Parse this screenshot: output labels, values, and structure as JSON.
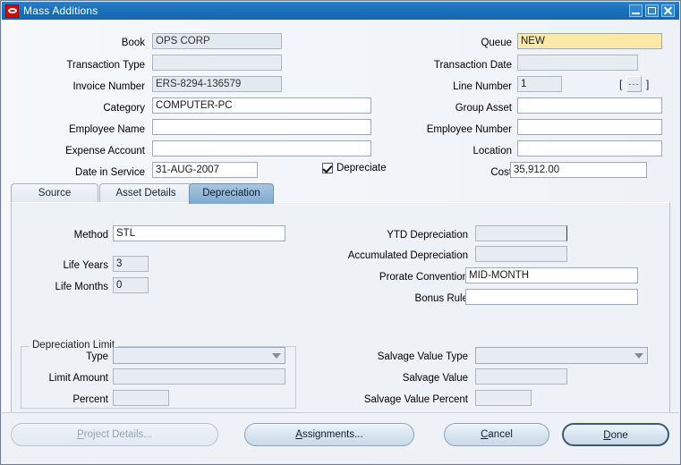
{
  "window": {
    "title": "Mass Additions",
    "logo_icon": "oracle-logo-icon",
    "minimize_label": "Minimize",
    "maximize_label": "Maximize",
    "close_label": "Close"
  },
  "header": {
    "left_fields": [
      {
        "label": "Book",
        "value": "OPS CORP",
        "state": "readonly"
      },
      {
        "label": "Transaction Type",
        "value": "",
        "state": "readonly"
      },
      {
        "label": "Invoice Number",
        "value": "ERS-8294-136579",
        "state": "readonly"
      },
      {
        "label": "Category",
        "value": "COMPUTER-PC",
        "state": "editable"
      },
      {
        "label": "Employee Name",
        "value": "",
        "state": "editable"
      },
      {
        "label": "Expense Account",
        "value": "",
        "state": "editable"
      },
      {
        "label": "Date in Service",
        "value": "31-AUG-2007",
        "state": "editable"
      }
    ],
    "right_fields": [
      {
        "label": "Queue",
        "value": "NEW",
        "state": "focused"
      },
      {
        "label": "Transaction Date",
        "value": "",
        "state": "readonly"
      },
      {
        "label": "Line Number",
        "value": "1",
        "state": "readonly"
      },
      {
        "label": "Group Asset",
        "value": "",
        "state": "editable"
      },
      {
        "label": "Employee Number",
        "value": "",
        "state": "editable"
      },
      {
        "label": "Location",
        "value": "",
        "state": "editable"
      },
      {
        "label": "Cost",
        "value": "35,912.00",
        "state": "editable"
      }
    ],
    "lov": {
      "open_bracket": "[",
      "button_label": "...",
      "close_bracket": "]"
    },
    "depreciate": {
      "label": "Depreciate",
      "checked": true
    }
  },
  "tabs": [
    {
      "label": "Source",
      "active": false
    },
    {
      "label": "Asset Details",
      "active": false
    },
    {
      "label": "Depreciation",
      "active": true
    }
  ],
  "depreciation": {
    "left_fields": [
      {
        "label": "Method",
        "value": "STL",
        "state": "editable"
      },
      {
        "label": "Life Years",
        "value": "3",
        "state": "readonly"
      },
      {
        "label": "Life Months",
        "value": "0",
        "state": "readonly"
      }
    ],
    "right_fields": [
      {
        "label": "YTD Depreciation",
        "value": "",
        "state": "readonly"
      },
      {
        "label": "Accumulated Depreciation",
        "value": "",
        "state": "readonly"
      },
      {
        "label": "Prorate Convention",
        "value": "MID-MONTH",
        "state": "editable"
      },
      {
        "label": "Bonus Rule",
        "value": "",
        "state": "editable"
      }
    ],
    "limit_group": {
      "title": "Depreciation Limit",
      "type": {
        "label": "Type",
        "value": ""
      },
      "limit_amount": {
        "label": "Limit Amount",
        "value": ""
      },
      "percent": {
        "label": "Percent",
        "value": ""
      }
    },
    "salvage": {
      "type": {
        "label": "Salvage Value Type",
        "value": ""
      },
      "value": {
        "label": "Salvage Value",
        "value": ""
      },
      "percent": {
        "label": "Salvage Value Percent",
        "value": ""
      }
    }
  },
  "buttons": [
    {
      "label": "Project Details...",
      "mnemonic": "P",
      "disabled": true,
      "default": false
    },
    {
      "label": "Assignments...",
      "mnemonic": "A",
      "disabled": false,
      "default": false
    },
    {
      "label": "Cancel",
      "mnemonic": "C",
      "disabled": false,
      "default": false
    },
    {
      "label": "Done",
      "mnemonic": "D",
      "disabled": false,
      "default": true
    }
  ],
  "colors": {
    "titlebar": "#1a70ba",
    "canvas": "#eef2f7",
    "focus_field": "#fbe9a8",
    "active_tab": "#7fa9cf",
    "logo_red": "#d10b0b"
  }
}
